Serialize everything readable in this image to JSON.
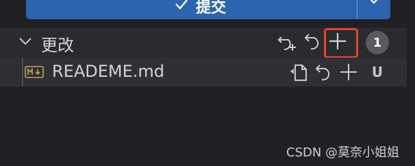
{
  "commit_button": {
    "label": "提交"
  },
  "changes_section": {
    "title": "更改",
    "count": "1"
  },
  "files": [
    {
      "name": "READEME.md",
      "status": "U"
    }
  ],
  "watermark": "CSDN @莫奈小姐姐",
  "colors": {
    "background": "#202124",
    "commit_blue": "#2d64b0",
    "highlight_red": "#e8432f",
    "badge_gray": "#5a5b5e",
    "md_icon": "#c7a455"
  },
  "icons": [
    "check-icon",
    "chevron-down-icon",
    "open-file-icon",
    "discard-changes-icon",
    "stage-changes-icon",
    "markdown-file-icon"
  ]
}
